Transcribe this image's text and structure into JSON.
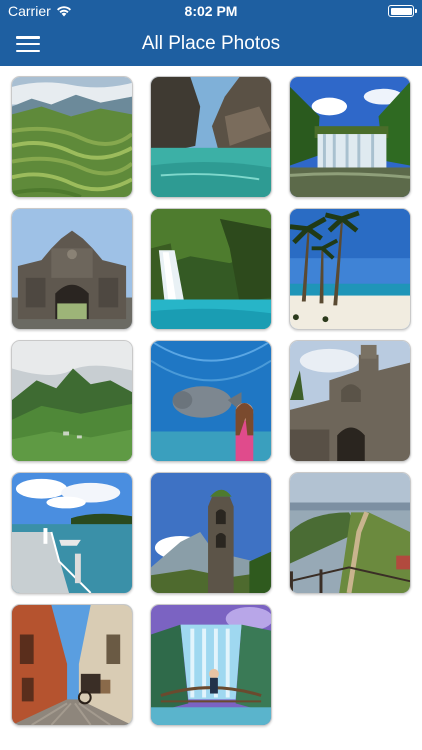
{
  "status_bar": {
    "carrier": "Carrier",
    "time": "8:02 PM"
  },
  "nav": {
    "title": "All Place Photos",
    "menu_icon": "hamburger-menu-icon"
  },
  "colors": {
    "nav_background": "#1e5fa1",
    "nav_text": "#ffffff",
    "page_background": "#ffffff"
  },
  "photos": [
    {
      "id": "photo-rice-terraces",
      "subject": "rice terraces mountain valley"
    },
    {
      "id": "photo-limestone-lagoon",
      "subject": "limestone cliffs turquoise lagoon"
    },
    {
      "id": "photo-waterfall-jungle",
      "subject": "wide waterfall in jungle"
    },
    {
      "id": "photo-stone-gate",
      "subject": "ornate stone fort gate"
    },
    {
      "id": "photo-waterfall-blue-pool",
      "subject": "waterfall with blue pool"
    },
    {
      "id": "photo-palm-beach",
      "subject": "palm trees white sand beach"
    },
    {
      "id": "photo-green-mountains",
      "subject": "forested mountains"
    },
    {
      "id": "photo-aquarium-manatee",
      "subject": "aquarium tunnel with manatee"
    },
    {
      "id": "photo-old-fort-wall",
      "subject": "old stone fort wall"
    },
    {
      "id": "photo-seaside-pier",
      "subject": "seaside pier with boats"
    },
    {
      "id": "photo-church-ruins",
      "subject": "stone church tower ruins"
    },
    {
      "id": "photo-lake-trail",
      "subject": "ridge trail above lake"
    },
    {
      "id": "photo-colonial-street",
      "subject": "colonial street with carriage"
    },
    {
      "id": "photo-waterfall-mural",
      "subject": "waterfall 3d mural"
    }
  ]
}
